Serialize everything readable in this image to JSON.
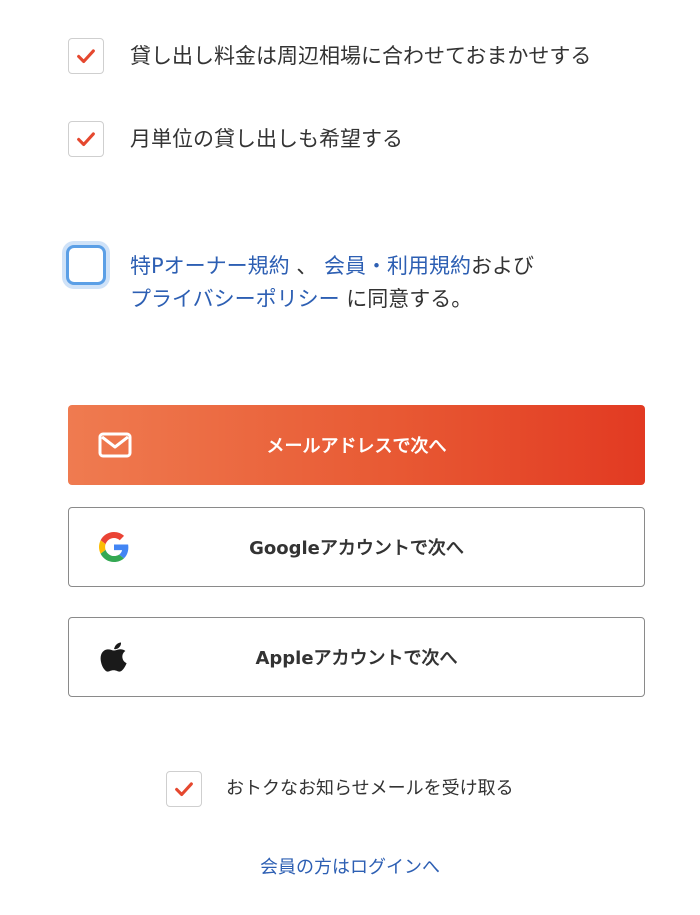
{
  "options": [
    {
      "label": "貸し出し料金は周辺相場に合わせておまかせする",
      "checked": true
    },
    {
      "label": "月単位の貸し出しも希望する",
      "checked": true
    }
  ],
  "terms": {
    "checked": false,
    "link_owner_terms": "特Pオーナー規約",
    "sep1": "、",
    "link_member_terms": "会員・利用規約",
    "and_text": "および",
    "link_privacy": "プライバシーポリシー",
    "suffix": "に同意する。"
  },
  "buttons": {
    "email": "メールアドレスで次へ",
    "google": "Googleアカウントで次へ",
    "apple": "Appleアカウントで次へ"
  },
  "newsletter": {
    "label": "おトクなお知らせメールを受け取る",
    "checked": true
  },
  "login_link": "会員の方はログインへ",
  "icons": {
    "email": "mail-icon",
    "google": "google-logo-icon",
    "apple": "apple-logo-icon",
    "check": "checkmark-icon"
  },
  "colors": {
    "check": "#e5482f",
    "link": "#2d5fb3",
    "email_button_start": "#ef7b50",
    "email_button_end": "#e23a22",
    "focus_ring": "#5b9fe6"
  }
}
